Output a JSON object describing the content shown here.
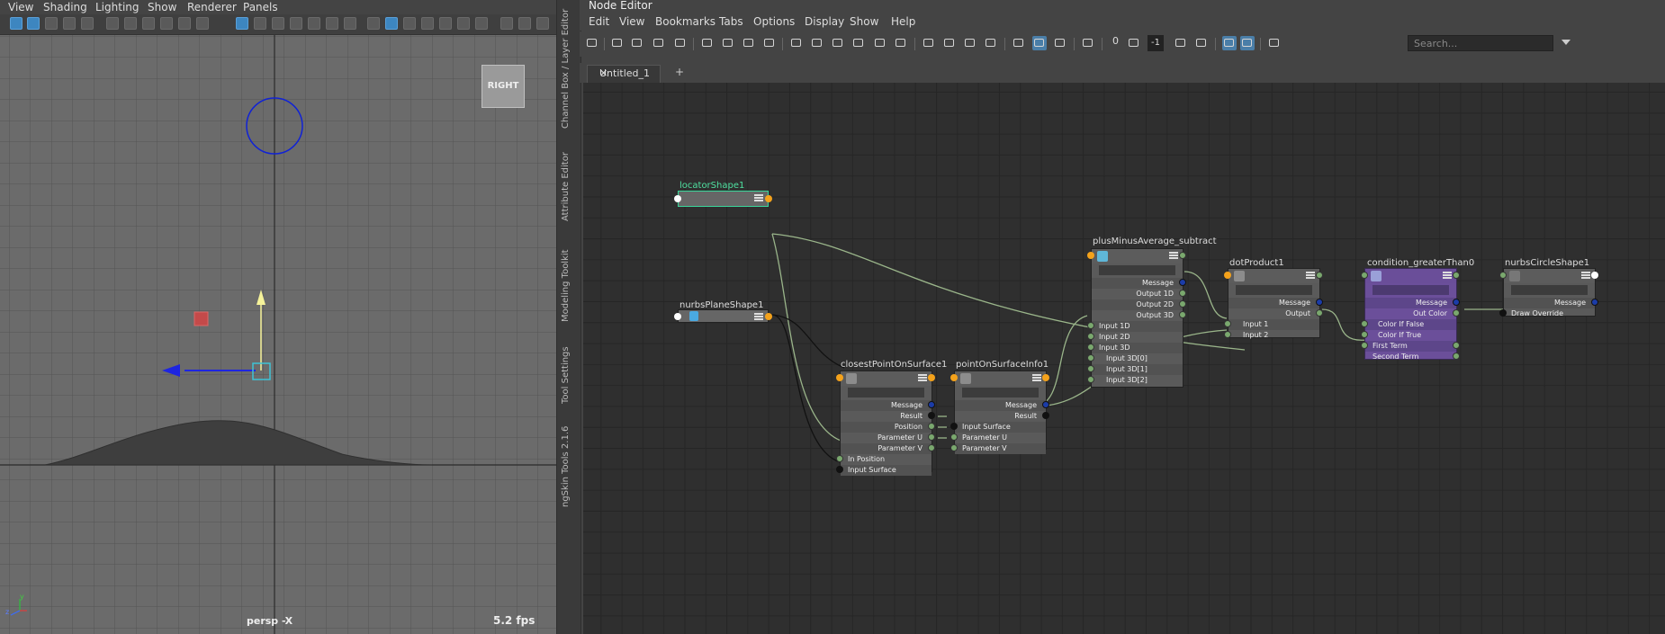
{
  "viewport": {
    "menu": [
      "View",
      "Shading",
      "Lighting",
      "Show",
      "Renderer",
      "Panels"
    ],
    "view_cube_label": "RIGHT",
    "camera_label": "persp -X",
    "fps": "5.2 fps",
    "axis_y": "y",
    "axis_z": "z"
  },
  "side_tabs": [
    "Channel Box / Layer Editor",
    "Attribute Editor",
    "Modeling Toolkit",
    "Tool Settings",
    "ngSkin Tools 2.1.6"
  ],
  "node_editor": {
    "title": "Node Editor",
    "menu": [
      "Edit",
      "View",
      "Bookmarks",
      "Tabs",
      "Options",
      "Display",
      "Show",
      "Help"
    ],
    "toolbar": {
      "counter_zero": "0",
      "counter_minus_one": "-1",
      "search_placeholder": "Search..."
    },
    "tab_label": "Untitled_1",
    "add_tab": "+",
    "nodes": {
      "locator": {
        "title": "locatorShape1"
      },
      "nurbsPlane": {
        "title": "nurbsPlaneShape1"
      },
      "closestPoint": {
        "title": "closestPointOnSurface1",
        "rows": [
          "Message",
          "Result",
          "Position",
          "Parameter U",
          "Parameter V",
          "In Position",
          "Input Surface"
        ]
      },
      "pointOnSurface": {
        "title": "pointOnSurfaceInfo1",
        "rows": [
          "Message",
          "Result",
          "Input Surface",
          "Parameter U",
          "Parameter V"
        ]
      },
      "plusMinus": {
        "title": "plusMinusAverage_subtract",
        "rows": [
          "Message",
          "Output 1D",
          "Output 2D",
          "Output 3D",
          "Input 1D",
          "Input 2D",
          "Input 3D",
          "Input 3D[0]",
          "Input 3D[1]",
          "Input 3D[2]"
        ]
      },
      "dotProduct": {
        "title": "dotProduct1",
        "rows": [
          "Message",
          "Output",
          "Input 1",
          "Input 2"
        ]
      },
      "condition": {
        "title": "condition_greaterThan0",
        "rows": [
          "Message",
          "Out Color",
          "Color If False",
          "Color If True",
          "First Term",
          "Second Term"
        ]
      },
      "nurbsCircle": {
        "title": "nurbsCircleShape1",
        "rows": [
          "Message",
          "Draw Override"
        ]
      }
    }
  },
  "colors": {
    "accent_blue": "#3d86c0",
    "port_orange": "#f4a21b",
    "wire_green": "#9ab58a",
    "condition_purple": "#6b4f9a",
    "locator_highlight": "#3ad69a"
  }
}
